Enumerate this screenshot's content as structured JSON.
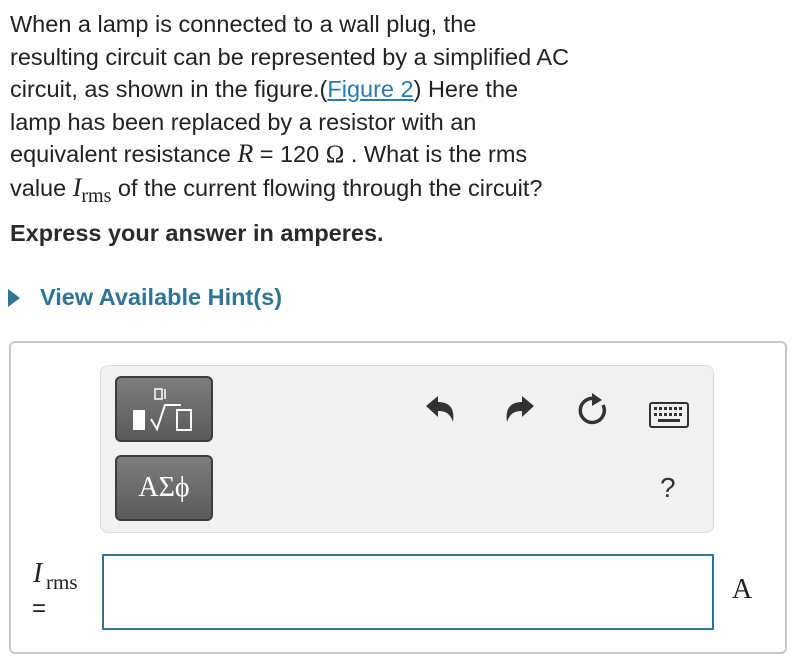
{
  "question": {
    "p1": "When a lamp is connected to a wall plug, the",
    "p2": "resulting circuit can be represented by a simplified AC",
    "p3a": "circuit, as shown in the figure.(",
    "figure_link": "Figure 2",
    "p3b": ") Here the",
    "p4": "lamp has been replaced by a resistor with an",
    "p5a": "equivalent resistance ",
    "R_sym": "R",
    "p5b": " = 120 ",
    "ohm": "Ω",
    "p5c": " . What is the rms",
    "p6a": "value ",
    "I_sym": "I",
    "rms_sub": "rms",
    "p6b": " of the current flowing through the circuit?"
  },
  "instruction": "Express your answer in amperes.",
  "hint_label": "View Available Hint(s)",
  "toolbar": {
    "greek_label": "ΑΣϕ",
    "help_label": "?",
    "icons": [
      "templates-icon",
      "undo-icon",
      "redo-icon",
      "reset-icon",
      "keyboard-icon"
    ]
  },
  "answer": {
    "var_main": "I",
    "var_sub": "rms",
    "equals": "=",
    "value": "",
    "unit": "A"
  },
  "colors": {
    "link": "#2a7ab0",
    "hint": "#2f7595",
    "input_border": "#2f7595",
    "button_bg": "#6b6b6b"
  }
}
